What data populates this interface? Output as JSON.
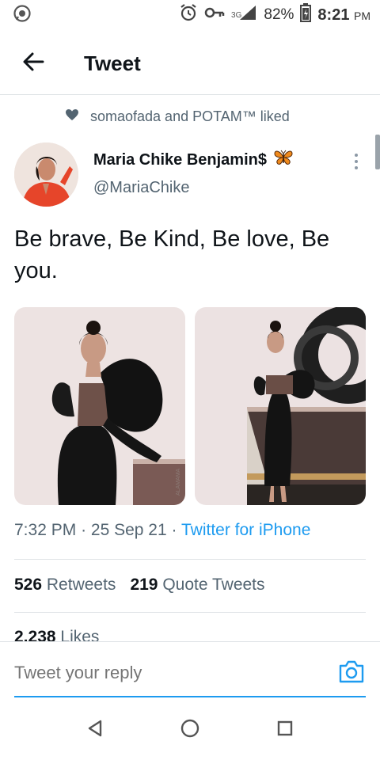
{
  "status_bar": {
    "network": "3G",
    "battery": "82%",
    "time": "8:21",
    "ampm": "PM",
    "icons": [
      "whatsapp-icon",
      "alarm-icon",
      "key-icon",
      "signal-icon",
      "battery-charging-icon"
    ]
  },
  "header": {
    "title": "Tweet",
    "back_icon": "arrow-left-icon"
  },
  "social_context": {
    "text": "somaofada and POTAM™ liked",
    "icon": "heart-icon"
  },
  "author": {
    "name": "Maria Chike Benjamin$",
    "handle": "@MariaChike",
    "emoji_icon": "butterfly-icon"
  },
  "tweet": {
    "text": "Be brave, Be Kind, Be love, Be you."
  },
  "media": {
    "count": 2,
    "watermark": "ALAMAMA"
  },
  "meta": {
    "time": "7:32 PM",
    "separator": "·",
    "date": "25 Sep 21",
    "source": "Twitter for iPhone"
  },
  "stats": {
    "retweets_count": "526",
    "retweets_label": "Retweets",
    "quotes_count": "219",
    "quotes_label": "Quote Tweets",
    "likes_count": "2,238",
    "likes_label": "Likes"
  },
  "reply": {
    "placeholder": "Tweet your reply"
  },
  "colors": {
    "accent": "#1d9bf0",
    "text_primary": "#0f1419",
    "text_secondary": "#536471",
    "divider": "#dfe3e6"
  }
}
